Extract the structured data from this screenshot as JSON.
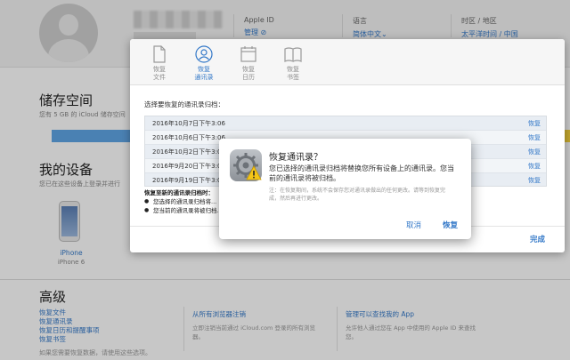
{
  "header": {
    "apple_id_label": "Apple ID",
    "apple_id_value": "管理 ⊘",
    "language_label": "语言",
    "language_value": "简体中文⌄",
    "region_label": "时区 / 地区",
    "region_value": "太平洋时间 / 中国"
  },
  "storage": {
    "title": "储存空间",
    "subtitle": "您有 5 GB 的 iCloud 储存空间"
  },
  "devices": {
    "title": "我的设备",
    "subtitle": "您已在这些设备上登录并进行",
    "device_name": "iPhone",
    "device_model": "iPhone 6"
  },
  "advanced": {
    "title": "高级",
    "links": [
      "恢复文件",
      "恢复通讯录",
      "恢复日历和提醒事项",
      "恢复书签"
    ],
    "note": "如果您需要恢复数据，请使用这些选项。",
    "col2_title": "从所有浏览器注销",
    "col2_desc": "立即注销当前通过 iCloud.com 登录的所有浏览器。",
    "col3_title": "管理可以查找我的 App",
    "col3_desc": "允许他人通过您在 App 中使用的 Apple ID 来查找您。"
  },
  "panel": {
    "tabs": [
      {
        "label": "恢复\n文件",
        "icon": "file-icon"
      },
      {
        "label": "恢复\n通讯录",
        "icon": "contacts-icon"
      },
      {
        "label": "恢复\n日历",
        "icon": "calendar-icon"
      },
      {
        "label": "恢复\n书签",
        "icon": "bookmarks-icon"
      }
    ],
    "prompt": "选择要恢复的通讯录归档：",
    "archives": [
      {
        "date": "2016年10月7日下午3:06",
        "action": "恢复"
      },
      {
        "date": "2016年10月6日下午3:06",
        "action": "恢复"
      },
      {
        "date": "2016年10月2日下午3:06",
        "action": "恢复"
      },
      {
        "date": "2016年9月20日下午3:06",
        "action": "恢复"
      },
      {
        "date": "2016年9月19日下午3:06",
        "action": "恢复"
      }
    ],
    "note_title": "恢复至新的通讯录归档时：",
    "note_items": [
      "您选择的通讯录归档将...",
      "您当前的通讯录将被归档..."
    ],
    "done_label": "完成"
  },
  "dialog": {
    "title": "恢复通讯录？",
    "message": "您已选择的通讯录归档将替换您所有设备上的通讯录。您当前的通讯录将被归档。",
    "note": "注：在恢复期间，系统不会保存您对通讯录做出的任何更改。请等到恢复完成，然后再进行更改。",
    "cancel_label": "取消",
    "restore_label": "恢复"
  },
  "colors": {
    "accent": "#3378c8",
    "storage_fill": "#5fa6e6",
    "storage_other": "#f6d23c"
  }
}
